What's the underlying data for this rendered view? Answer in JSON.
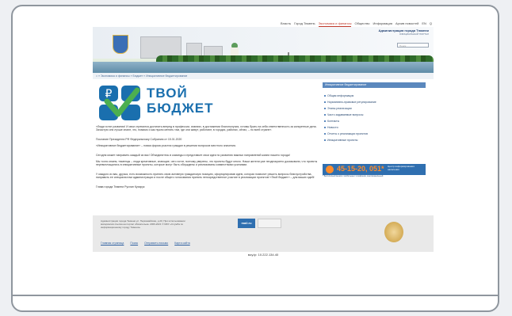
{
  "nav": {
    "items": [
      "Власть",
      "Город Тюмень",
      "Экономика и финансы",
      "Общество",
      "Информация",
      "Архив новостей",
      "EN",
      "Q"
    ],
    "active_index": 2
  },
  "header": {
    "title": "Администрация города Тюмени",
    "subtitle": "ОФИЦИАЛЬНЫЙ ПОРТАЛ",
    "search_placeholder": "Поиск"
  },
  "breadcrumb": "⌂ » Экономика и финансы » Бюджет » Инициативное бюджетирование",
  "logo": {
    "line1": "ТВОЙ",
    "line2": "БЮДЖЕТ"
  },
  "content": {
    "p1": "«Люди хотят развития! И свои стремятся достигать вперед в профессии, знаниях, в достижении благополучия, готовы брать на себя ответственность за конкретные дела. Зачастую они лучше знают, что, помимо и как нужно менять там, где они живут, работают, в городах, районах, сёлах, – по всей стране».",
    "p2": "Послание Президента РФ Федеральному Собранию от 15.01.2020",
    "p3": "«Инициативное бюджетирование» – новая форма участия граждан в решении вопросов местного значения.",
    "p4": "Сегодня может направить каждый из вас! Объединитесь в команды и представьте свои идеи по развитию важных направлений жизни нашего города!",
    "p5": "Мы точно знаем, тюменцы – люди креативные, знающие, чего хотят, поэтому уверены, что проекты будут много. Наши жители уже неоднократно доказывали, что проекты перевоплощались в инициативные проекты, которые могут быть обсуждены и реализованы совместными усилиями.",
    "p6": "У каждого из вас, друзья, есть возможность принять свою активную гражданскую позицию, сформулировав идею, которая позволит решить вопросы благоустройства, направить ее специалистам администрации и после общего голосования принять непосредственное участие в реализации проектов! «Твой бюджет» – для ваших идей!",
    "p7": "Глава города Тюмени Руслан Кухарук"
  },
  "sidebar": {
    "heading": "Инициативное бюджетирование",
    "items": [
      "Общая информация",
      "Нормативно-правовое регулирование",
      "Этапы реализации",
      "Часто задаваемые вопросы",
      "Контакты",
      "Новости",
      "Отчеты о реализации проектов",
      "Инициативные проекты"
    ],
    "phone": "45-15-20, 051*",
    "phone_label": "Центр информирования населения",
    "phone_note": "* Бесплатный вызов с мобильных телефонов, многоканальный"
  },
  "footer": {
    "info": "Администрация города Тюмени ул. Первомайская, д.20. При использовании материалов ссылка на портал обязательна. 2006-2021 © МКУ «Служба по информационному городу Тюмени»",
    "links": [
      "Главная страница",
      "Поиск",
      "Отправить письмо",
      "Карта сайта"
    ],
    "counter": "mail.ru"
  },
  "ip": "мсу.ip: 10.222.134.40",
  "colors": {
    "accent": "#5b88bd",
    "logo_blue": "#1a6fae",
    "phone_orange": "#ff8c2a",
    "nav_active": "#c0392b"
  }
}
